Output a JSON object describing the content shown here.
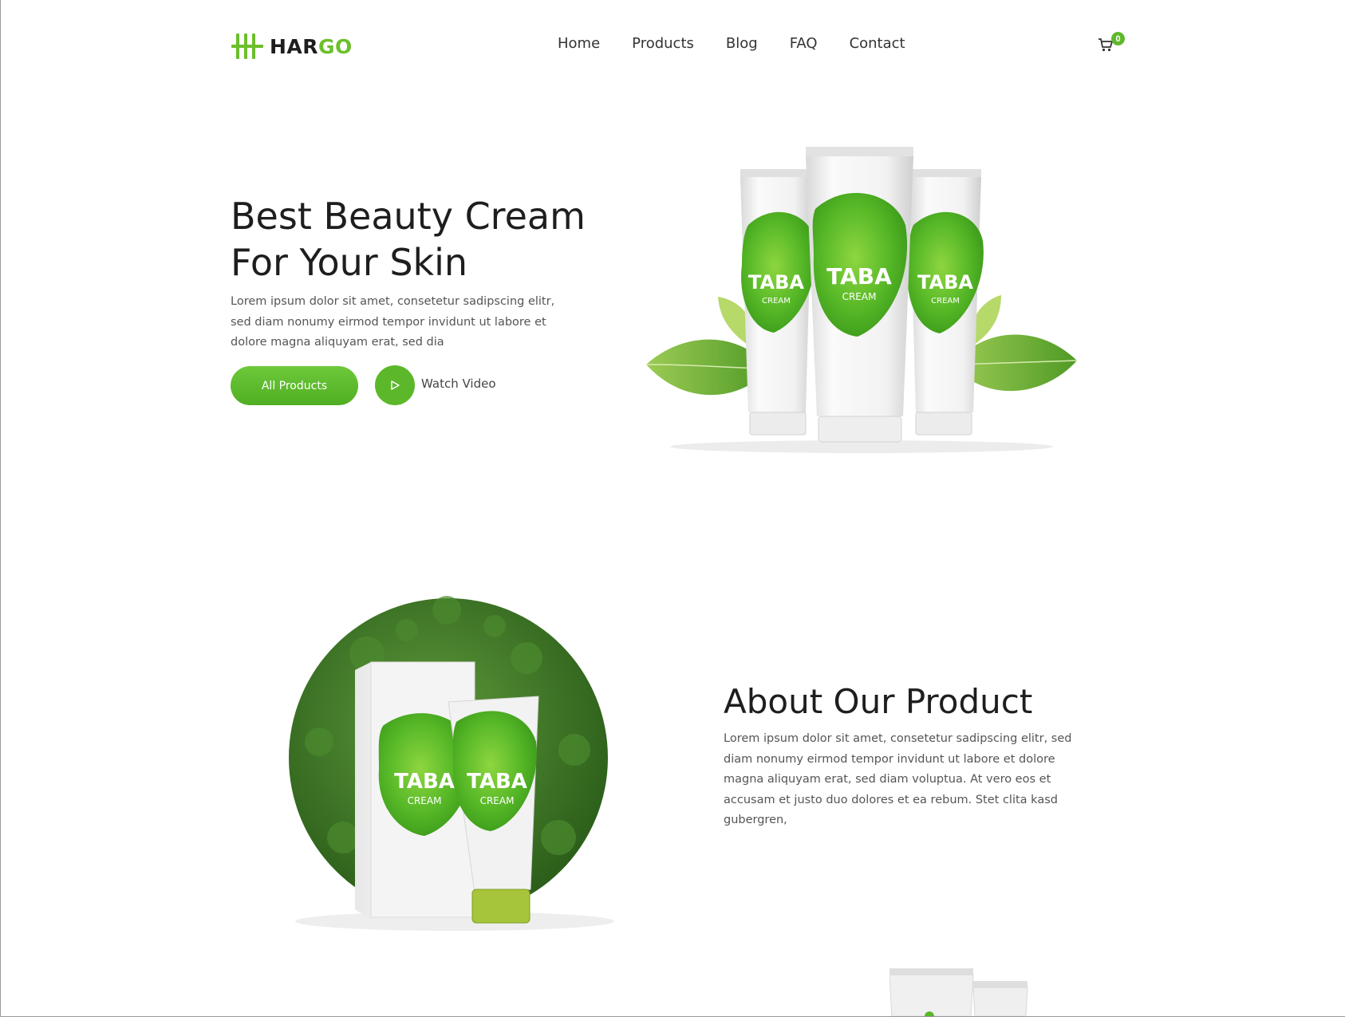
{
  "header": {
    "logo": {
      "part1": "HAR",
      "part2": "GO"
    },
    "nav": [
      "Home",
      "Products",
      "Blog",
      "FAQ",
      "Contact"
    ],
    "cart_count": "0"
  },
  "hero": {
    "title_line1": "Best Beauty Cream",
    "title_line2": "For Your Skin",
    "description": "Lorem ipsum dolor sit amet, consetetur sadipscing elitr, sed diam nonumy eirmod tempor invidunt ut labore et dolore magna aliquyam erat, sed dia",
    "primary_button": "All Products",
    "video_label": "Watch Video"
  },
  "product_label": {
    "brand": "TABA",
    "type": "CREAM"
  },
  "about": {
    "title": "About Our Product",
    "description": "Lorem ipsum dolor sit amet, consetetur sadipscing elitr, sed diam nonumy eirmod tempor invidunt ut labore et dolore magna aliquyam erat, sed diam voluptua. At vero eos et accusam et justo duo dolores et ea rebum. Stet clita kasd gubergren,"
  },
  "colors": {
    "accent": "#5cb82a",
    "text": "#1e1e1e",
    "muted": "#555555"
  },
  "icons": [
    "logo-mark-icon",
    "cart-icon",
    "play-icon"
  ]
}
